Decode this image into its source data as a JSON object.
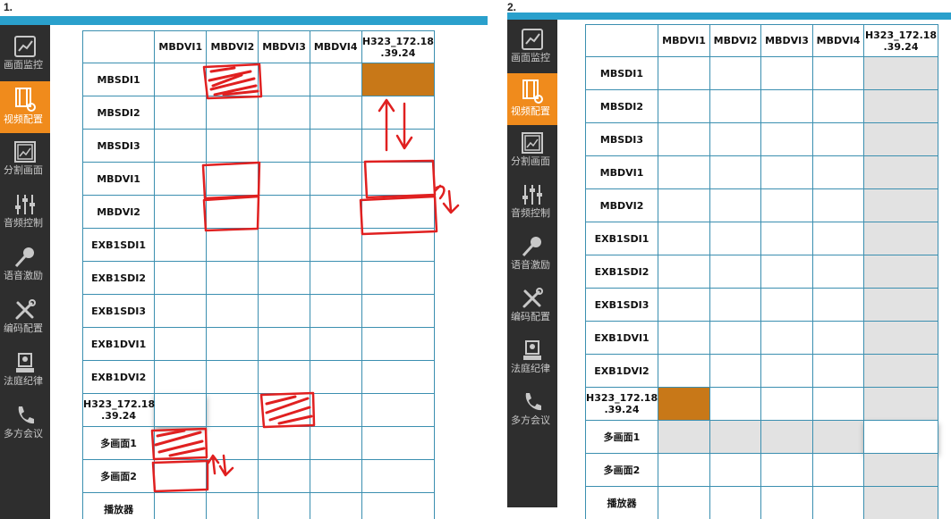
{
  "panel1": {
    "label": "1.",
    "columns": [
      "MBDVI1",
      "MBDVI2",
      "MBDVI3",
      "MBDVI4",
      "H323_172.18.39.24"
    ],
    "rows": [
      "MBSDI1",
      "MBSDI2",
      "MBSDI3",
      "MBDVI1",
      "MBDVI2",
      "EXB1SDI1",
      "EXB1SDI2",
      "EXB1SDI3",
      "EXB1DVI1",
      "EXB1DVI2",
      "H323_172.18.39.24",
      "多画面1",
      "多画面2",
      "播放器"
    ]
  },
  "panel2": {
    "label": "2.",
    "columns": [
      "MBDVI1",
      "MBDVI2",
      "MBDVI3",
      "MBDVI4",
      "H323_172.18.39.24"
    ],
    "rows": [
      "MBSDI1",
      "MBSDI2",
      "MBSDI3",
      "MBDVI1",
      "MBDVI2",
      "EXB1SDI1",
      "EXB1SDI2",
      "EXB1SDI3",
      "EXB1DVI1",
      "EXB1DVI2",
      "H323_172.18.39.24",
      "多画面1",
      "多画面2",
      "播放器"
    ]
  },
  "sidebar": {
    "items": [
      {
        "label": "画面监控",
        "icon": "monitor-chart-icon",
        "active": false
      },
      {
        "label": "视频配置",
        "icon": "video-settings-icon",
        "active": true
      },
      {
        "label": "分割画面",
        "icon": "split-screen-icon",
        "active": false
      },
      {
        "label": "音频控制",
        "icon": "audio-mixer-icon",
        "active": false
      },
      {
        "label": "语音激励",
        "icon": "microphone-icon",
        "active": false
      },
      {
        "label": "编码配置",
        "icon": "tools-icon",
        "active": false
      },
      {
        "label": "法庭纪律",
        "icon": "court-icon",
        "active": false
      },
      {
        "label": "多方会议",
        "icon": "phone-icon",
        "active": false
      }
    ]
  },
  "colors": {
    "accent_orange": "#f08b1c",
    "selected_cell": "#c87818",
    "grid_line": "#3b8fb0",
    "sidebar_bg": "#2e2e2e",
    "annotation_red": "#e02020",
    "disabled_cell": "#e2e2e2"
  }
}
